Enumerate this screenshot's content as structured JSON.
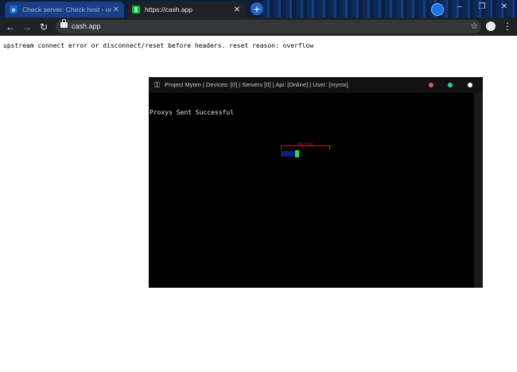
{
  "browser": {
    "tabs": [
      {
        "title": "Check server: Check host - online",
        "favicon": "e-logo-icon",
        "active": false
      },
      {
        "title": "https://cash.app",
        "favicon": "cash-app-icon",
        "active": true
      }
    ],
    "newtab_label": "+",
    "window_controls": {
      "minimize": "–",
      "restore": "❐",
      "close": "✕"
    },
    "nav": {
      "back": "←",
      "forward": "→",
      "reload": "↻"
    },
    "url": "cash.app",
    "star": "☆",
    "menu": "⋮"
  },
  "page": {
    "error_message": "upstream connect error or disconnect/reset before headers. reset reason: overflow"
  },
  "app": {
    "title": "Project Myten | Devices: [0] | Servers [0] | Api: [Online] | User: [myrox]",
    "console_output": "Proxys Sent Successful",
    "prompt_user": "myrox",
    "colors": {
      "close_dot": "#e6553d",
      "max_dot": "#2ecc9a",
      "min_dot": "#ffffff",
      "cursor": "#2fe02f"
    }
  }
}
